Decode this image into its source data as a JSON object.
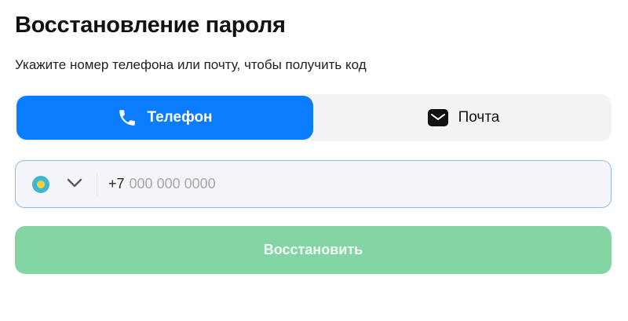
{
  "header": {
    "title": "Восстановление пароля",
    "subtitle": "Укажите номер телефона или почту, чтобы получить код"
  },
  "tabs": [
    {
      "label": "Телефон",
      "icon": "phone-icon",
      "active": true
    },
    {
      "label": "Почта",
      "icon": "mail-icon",
      "active": false
    }
  ],
  "phone": {
    "country_icon": "kazakhstan-flag-icon",
    "dial_code": "+7",
    "value": "",
    "placeholder": "000 000 0000"
  },
  "submit": {
    "label": "Восстановить",
    "enabled": false
  },
  "colors": {
    "accent": "#0a7cff",
    "submit_disabled": "#83d6a4",
    "field_border": "#8fbaf2",
    "tabs_background": "#f3f3f6"
  }
}
